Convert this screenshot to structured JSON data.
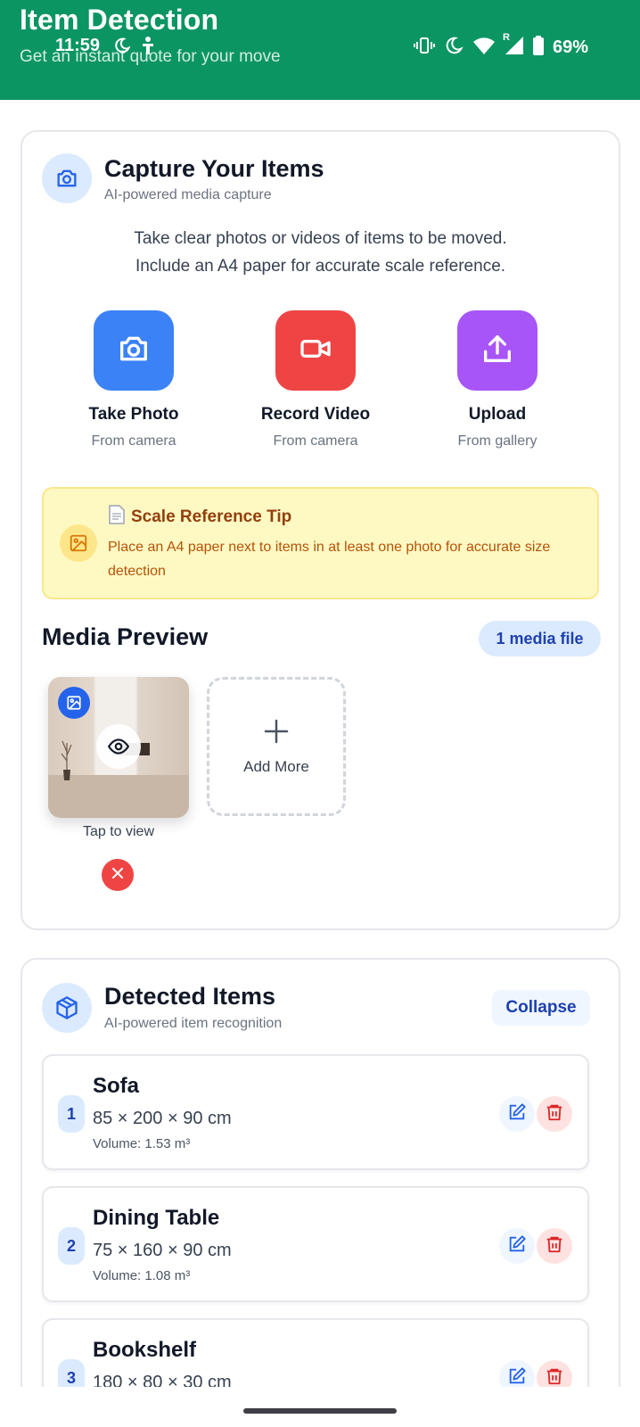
{
  "status_bar": {
    "time": "11:59",
    "battery": "69%",
    "left_icons": [
      "moon-sync-icon",
      "accessibility-icon"
    ],
    "right_icons": [
      "vibrate-icon",
      "do-not-disturb-icon",
      "wifi-icon",
      "signal-roaming-icon",
      "battery-icon"
    ],
    "roaming_label": "R"
  },
  "header": {
    "title": "Item Detection",
    "subtitle": "Get an instant quote for your move",
    "background": "#0b9562"
  },
  "capture": {
    "title": "Capture Your Items",
    "subtitle": "AI-powered media capture",
    "intro_line1": "Take clear photos or videos of items to be moved.",
    "intro_line2": "Include an A4 paper for accurate scale reference.",
    "actions": [
      {
        "label": "Take Photo",
        "sub": "From camera",
        "color": "#3b82f6",
        "icon": "camera-icon"
      },
      {
        "label": "Record Video",
        "sub": "From camera",
        "color": "#ef4444",
        "icon": "video-icon"
      },
      {
        "label": "Upload",
        "sub": "From gallery",
        "color": "#a855f7",
        "icon": "upload-icon"
      }
    ],
    "tip": {
      "title": "Scale Reference Tip",
      "text": "Place an A4 paper next to items in at least one photo for accurate size detection"
    }
  },
  "preview": {
    "title": "Media Preview",
    "badge": "1 media file",
    "tap_label": "Tap to view",
    "add_more": "Add More"
  },
  "detected": {
    "title": "Detected Items",
    "subtitle": "AI-powered item recognition",
    "collapse": "Collapse",
    "items": [
      {
        "num": "1",
        "name": "Sofa",
        "dims": "85 × 200 × 90 cm",
        "volume": "Volume: 1.53 m³"
      },
      {
        "num": "2",
        "name": "Dining Table",
        "dims": "75 × 160 × 90 cm",
        "volume": "Volume: 1.08 m³"
      },
      {
        "num": "3",
        "name": "Bookshelf",
        "dims": "180 × 80 × 30 cm",
        "volume": ""
      }
    ]
  }
}
